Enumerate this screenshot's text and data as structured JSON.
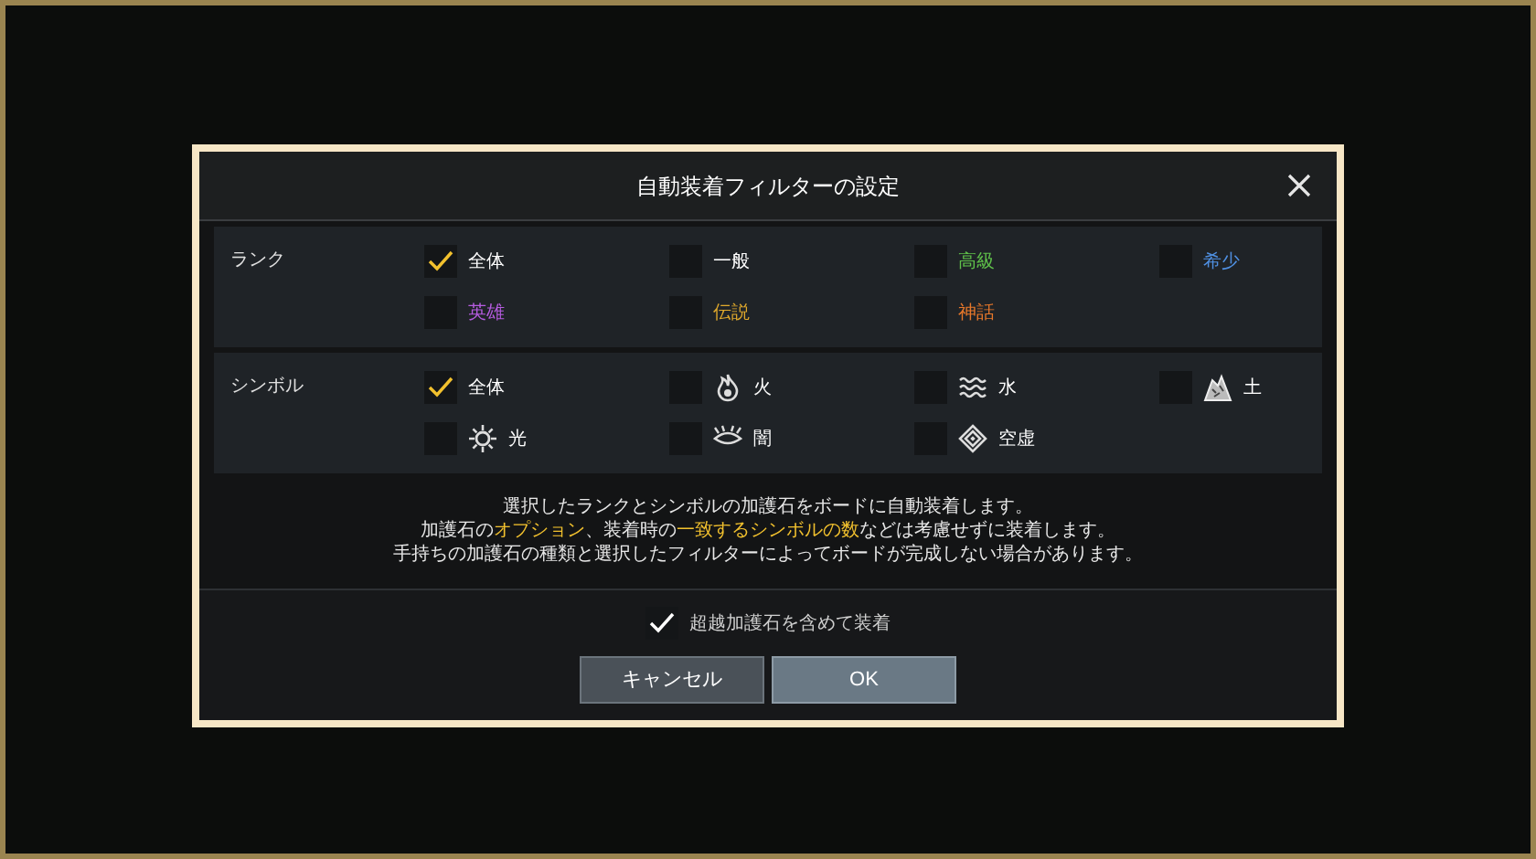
{
  "dialog": {
    "title": "自動装着フィルターの設定",
    "sections": [
      {
        "label": "ランク",
        "options": [
          {
            "label": "全体",
            "checked": true,
            "color": "#ffffff"
          },
          {
            "label": "一般",
            "checked": false,
            "color": "#ffffff"
          },
          {
            "label": "高級",
            "checked": false,
            "color": "#5fc04a"
          },
          {
            "label": "希少",
            "checked": false,
            "color": "#4f8fe0"
          },
          {
            "label": "英雄",
            "checked": false,
            "color": "#b65ce0"
          },
          {
            "label": "伝説",
            "checked": false,
            "color": "#e0a92c"
          },
          {
            "label": "神話",
            "checked": false,
            "color": "#e6772a"
          }
        ]
      },
      {
        "label": "シンボル",
        "options": [
          {
            "label": "全体",
            "checked": true,
            "kind": "all"
          },
          {
            "label": "火",
            "checked": false,
            "kind": "fire"
          },
          {
            "label": "水",
            "checked": false,
            "kind": "water"
          },
          {
            "label": "土",
            "checked": false,
            "kind": "earth"
          },
          {
            "label": "光",
            "checked": false,
            "kind": "light"
          },
          {
            "label": "闇",
            "checked": false,
            "kind": "dark"
          },
          {
            "label": "空虚",
            "checked": false,
            "kind": "void"
          }
        ]
      }
    ],
    "notice": [
      "選択したランクとシンボルの加護石をボードに自動装着します。",
      "加護石の**オプション**、装着時の**一致するシンボルの数**などは考慮せずに装着します。",
      "手持ちの加護石の種類と選択したフィルターによってボードが完成しない場合があります。"
    ],
    "include_option": {
      "label": "超越加護石を含めて装着",
      "checked": true
    },
    "buttons": [
      {
        "label": "キャンセル",
        "kind": "cancel"
      },
      {
        "label": "OK",
        "kind": "ok"
      }
    ]
  }
}
